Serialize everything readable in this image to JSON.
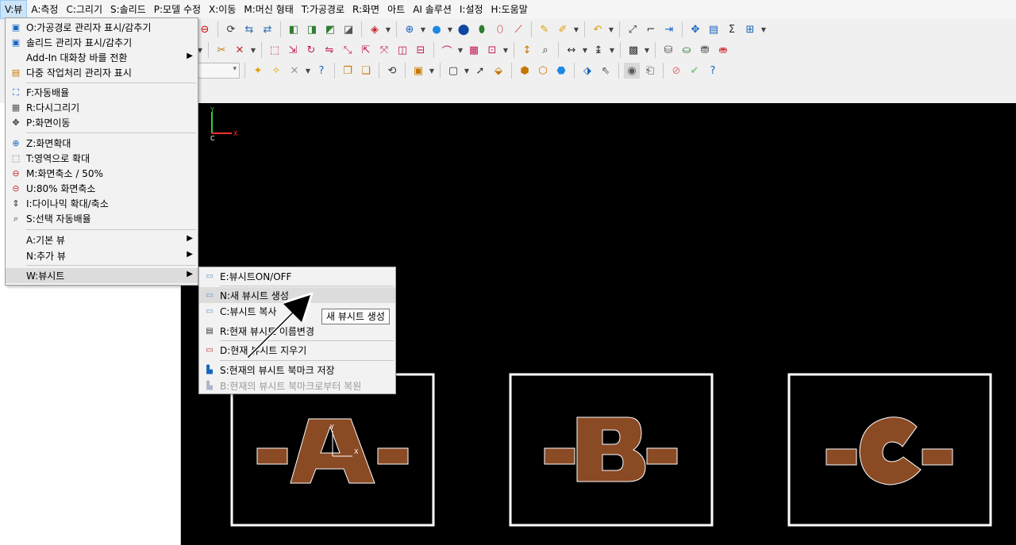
{
  "menubar": {
    "items": [
      {
        "label": "V:뷰"
      },
      {
        "label": "A:측정"
      },
      {
        "label": "C:그리기"
      },
      {
        "label": "S:솔리드"
      },
      {
        "label": "P:모델 수정"
      },
      {
        "label": "X:이동"
      },
      {
        "label": "M:머신 형태"
      },
      {
        "label": "T:가공경로"
      },
      {
        "label": "R:화면"
      },
      {
        "label": "아트"
      },
      {
        "label": "AI 솔루션"
      },
      {
        "label": "I:설정"
      },
      {
        "label": "H:도움말"
      }
    ]
  },
  "view_menu": {
    "items": [
      {
        "label": "O:가공경로 관리자 표시/감추기"
      },
      {
        "label": "솔리드 관리자 표시/감추기"
      },
      {
        "label": "Add-In 대화창 바를 전환"
      },
      {
        "label": "다중 작업처리 관리자 표시"
      },
      {
        "label": "F:자동배율"
      },
      {
        "label": "R:다시그리기"
      },
      {
        "label": "P:화면이동"
      },
      {
        "label": "Z:화면확대"
      },
      {
        "label": "T:영역으로 확대"
      },
      {
        "label": "M:화면축소 / 50%"
      },
      {
        "label": "U:80% 화면축소"
      },
      {
        "label": "I:다이나믹 확대/축소"
      },
      {
        "label": "S:선택 자동배율"
      },
      {
        "label": "A:기본 뷰"
      },
      {
        "label": "N:추가 뷰"
      },
      {
        "label": "W:뷰시트"
      }
    ]
  },
  "viewsheet_submenu": {
    "items": [
      {
        "label": "E:뷰시트ON/OFF"
      },
      {
        "label": "N:새 뷰시트 생성"
      },
      {
        "label": "C:뷰시트 복사"
      },
      {
        "label": "R:현재 뷰시트 이름변경"
      },
      {
        "label": "D:현재 뷰시트 지우기"
      },
      {
        "label": "S:현재의 뷰시트 북마크 저장"
      },
      {
        "label": "B:현재의 뷰시트 북마크로부터 복원"
      }
    ]
  },
  "tooltip": {
    "text": "새 뷰시트 생성"
  },
  "canvas": {
    "axes": {
      "y_label": "Y",
      "x_label": "X",
      "origin_label": "C"
    },
    "parts": [
      {
        "letter": "A",
        "axis_y": "Y",
        "axis_x": "X"
      },
      {
        "letter": "B"
      },
      {
        "letter": "C"
      }
    ]
  },
  "colors": {
    "canvas_bg": "#000000",
    "part_fill": "#8a4a24",
    "frame": "#ffffff",
    "axis_y": "#2ecc40",
    "axis_x": "#ff3030"
  }
}
